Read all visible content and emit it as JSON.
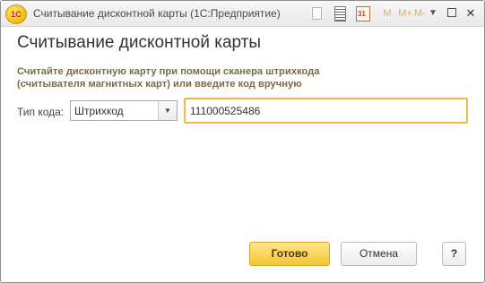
{
  "window": {
    "title": "Считывание дисконтной карты  (1С:Предприятие)",
    "logo_text": "1С",
    "toolbar": {
      "icons": [
        "doc-icon",
        "calculator-icon",
        "calendar-icon",
        "memory-m-icon",
        "memory-mplus-icon",
        "memory-mminus-icon",
        "more-icon",
        "restore-icon",
        "close-icon"
      ],
      "calendar_day": "31",
      "m_label": "M",
      "mplus_label": "M+",
      "mminus_label": "M-",
      "more_label": "▼",
      "close_label": "✕"
    }
  },
  "form": {
    "heading": "Считывание дисконтной карты",
    "instruction_line1": "Считайте дисконтную карту при помощи сканера штрихкода",
    "instruction_line2": "(считывателя магнитных карт) или введите код вручную",
    "code_type_label": "Тип кода:",
    "code_type_value": "Штрихкод",
    "code_value": "111000525486"
  },
  "buttons": {
    "ok": "Готово",
    "cancel": "Отмена",
    "help": "?"
  },
  "colors": {
    "accent_yellow": "#f6c531",
    "focus_border": "#f0b942",
    "instruction_text": "#7a6a46"
  }
}
